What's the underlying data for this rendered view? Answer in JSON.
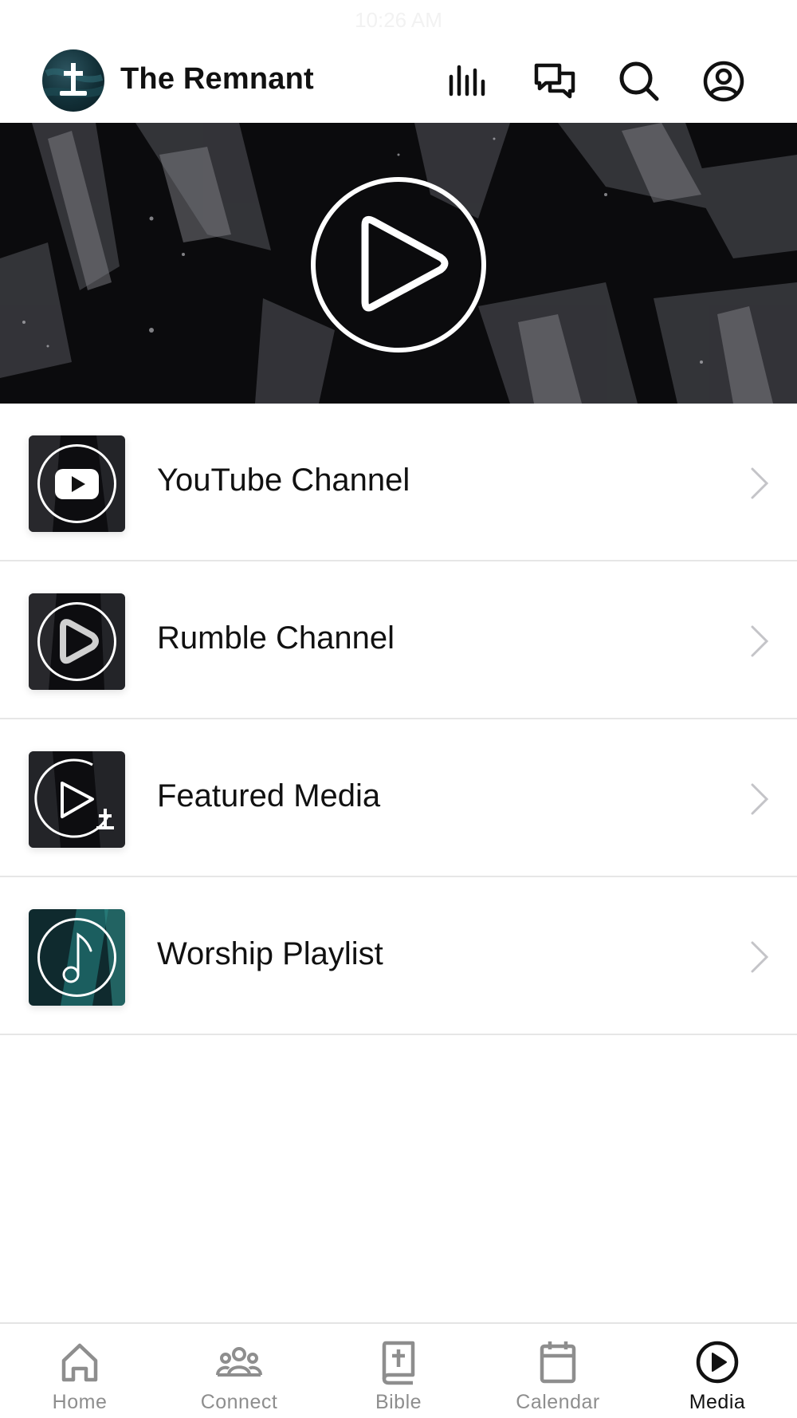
{
  "status_bar": {
    "time": "10:26 AM"
  },
  "header": {
    "title": "The Remnant",
    "icons": [
      "cross-logo-icon",
      "audio-bars-icon",
      "chat-bubbles-icon",
      "search-icon",
      "account-icon"
    ]
  },
  "hero": {
    "icon": "play-circle-icon"
  },
  "media_list": [
    {
      "label": "YouTube Channel",
      "icon": "youtube-icon"
    },
    {
      "label": "Rumble Channel",
      "icon": "rumble-icon"
    },
    {
      "label": "Featured Media",
      "icon": "play-cross-icon"
    },
    {
      "label": "Worship Playlist",
      "icon": "music-note-icon"
    }
  ],
  "tabbar": {
    "items": [
      {
        "label": "Home",
        "icon": "home-icon"
      },
      {
        "label": "Connect",
        "icon": "people-icon"
      },
      {
        "label": "Bible",
        "icon": "bible-icon"
      },
      {
        "label": "Calendar",
        "icon": "calendar-icon"
      },
      {
        "label": "Media",
        "icon": "play-circle-icon"
      }
    ],
    "active": "Media"
  },
  "colors": {
    "text": "#111111",
    "inactive_tab": "#8e8e8e",
    "divider": "#e6e6e6",
    "hero_bg": "#0b0b0d",
    "accent_teal": "#1e6b6b"
  }
}
